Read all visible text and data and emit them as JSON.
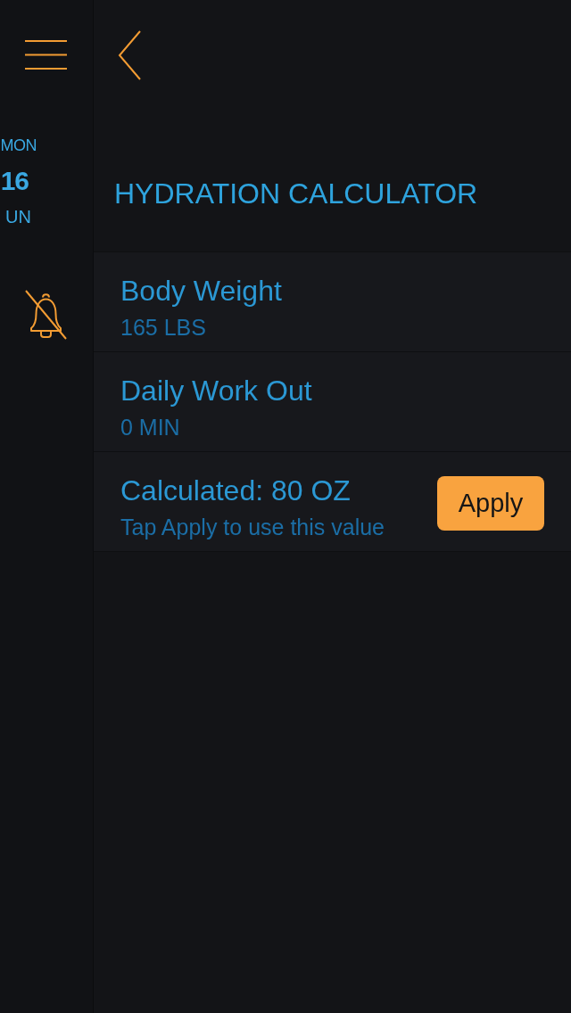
{
  "sidebar": {
    "date": {
      "weekday": "MON",
      "day": "16",
      "month": "UN"
    },
    "notifications_muted": true
  },
  "header": {
    "title": "HYDRATION CALCULATOR"
  },
  "rows": [
    {
      "kind": "value",
      "label": "Body Weight",
      "value": "165 LBS"
    },
    {
      "kind": "value",
      "label": "Daily Work Out",
      "value": "0 MIN"
    },
    {
      "kind": "result",
      "label": "Calculated: 80 OZ",
      "hint": "Tap Apply to use this value",
      "button": "Apply"
    }
  ]
}
